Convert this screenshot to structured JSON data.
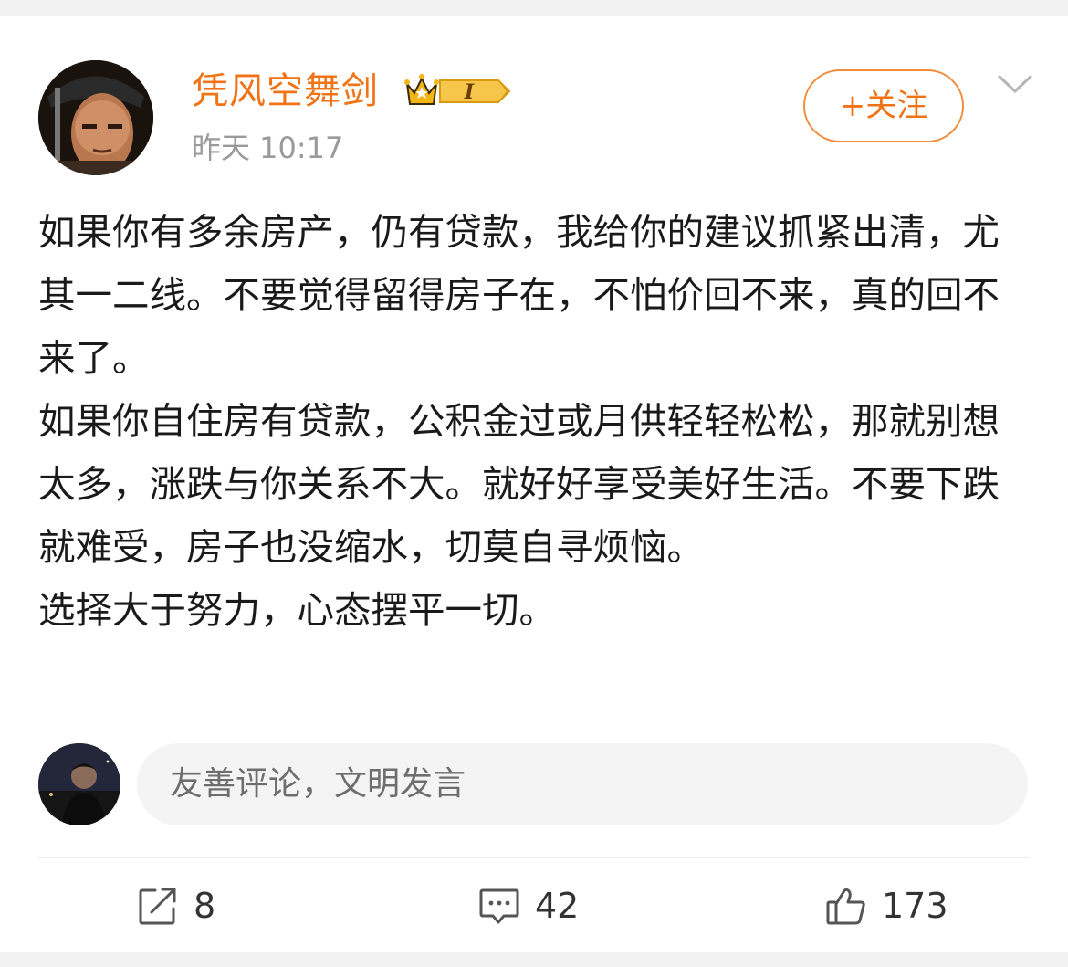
{
  "post": {
    "author": {
      "name": "凭风空舞剑",
      "badge_icon": "crown-vip-badge-icon",
      "badge_level": "I",
      "avatar_icon": "user-avatar"
    },
    "timestamp": "昨天 10:17",
    "follow_label": "+关注",
    "more_icon": "chevron-down-icon",
    "paragraphs": [
      "如果你有多余房产，仍有贷款，我给你的建议抓紧出清，尤其一二线。不要觉得留得房子在，不怕价回不来，真的回不来了。",
      "如果你自住房有贷款，公积金过或月供轻轻松松，那就别想太多，涨跌与你关系不大。就好好享受美好生活。不要下跌就难受，房子也没缩水，切莫自寻烦恼。",
      "选择大于努力，心态摆平一切。"
    ]
  },
  "comment_box": {
    "placeholder": "友善评论，文明发言"
  },
  "actions": {
    "repost_icon": "repost-icon",
    "repost_count": "8",
    "comment_icon": "comment-icon",
    "comment_count": "42",
    "like_icon": "thumbs-up-icon",
    "like_count": "173"
  },
  "colors": {
    "accent": "#f07316",
    "text": "#1a1a1a",
    "muted": "#9a9a9a",
    "background": "#f2f2f2"
  }
}
